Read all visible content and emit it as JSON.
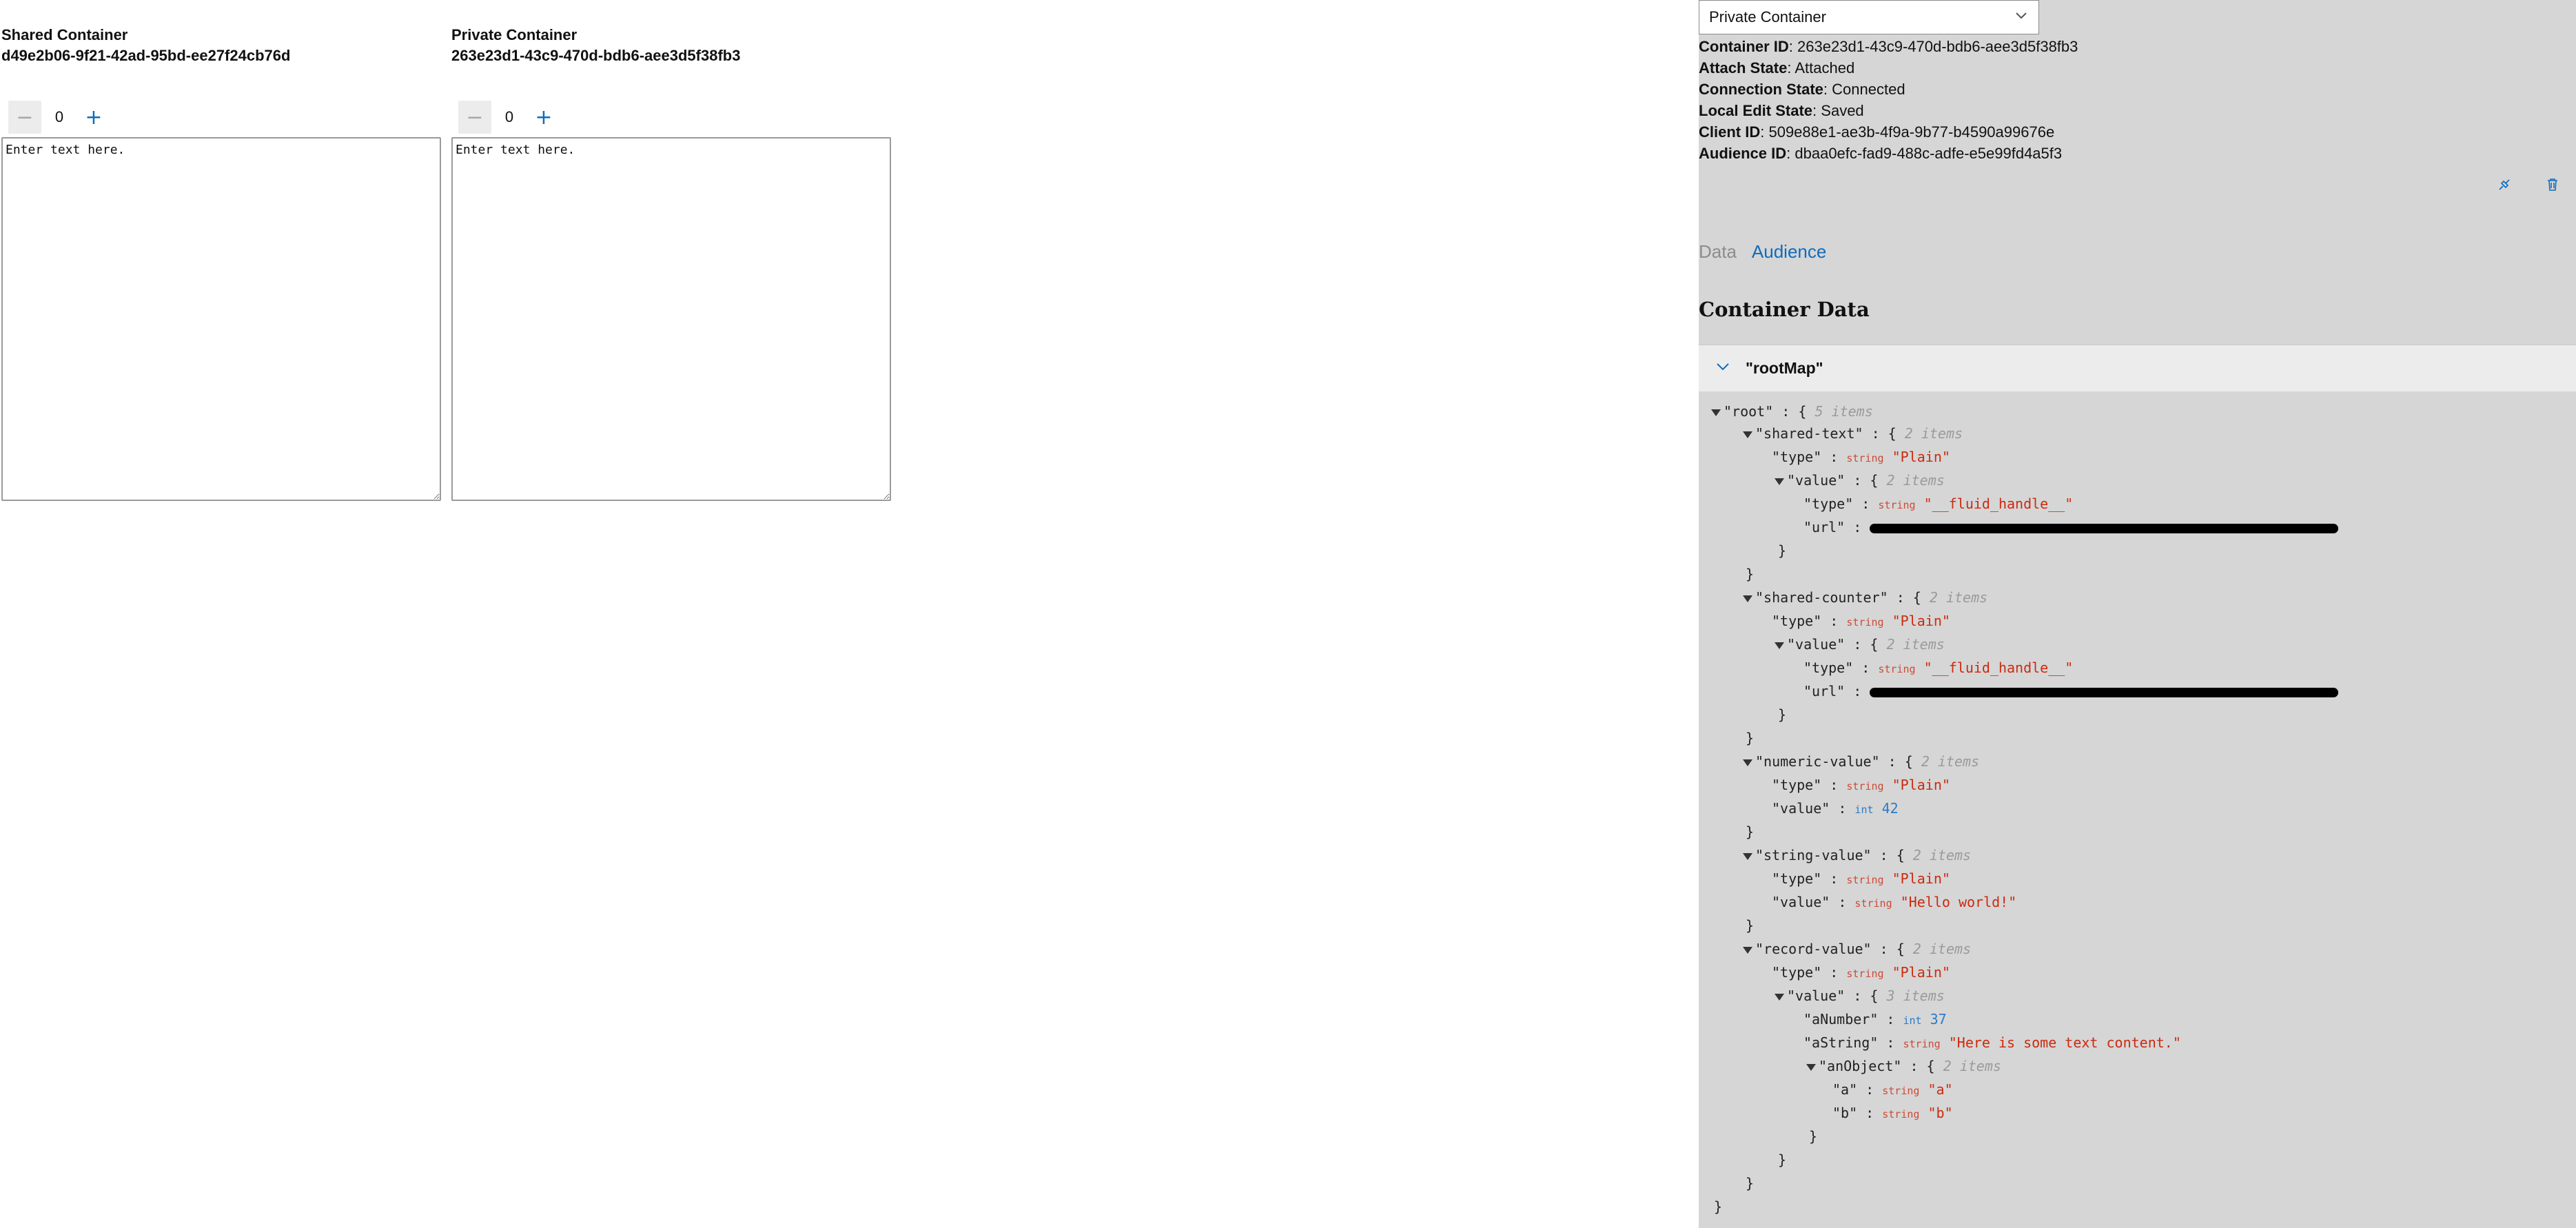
{
  "shared": {
    "title": "Shared Container",
    "id": "d49e2b06-9f21-42ad-95bd-ee27f24cb76d",
    "counter": "0",
    "decrement": "−",
    "increment": "+",
    "placeholder": "Enter text here."
  },
  "private": {
    "title": "Private Container",
    "id": "263e23d1-43c9-470d-bdb6-aee3d5f38fb3",
    "counter": "0",
    "decrement": "−",
    "increment": "+",
    "placeholder": "Enter text here."
  },
  "devtools": {
    "selected_container": "Private Container",
    "info": [
      {
        "label": "Container ID",
        "value": "263e23d1-43c9-470d-bdb6-aee3d5f38fb3"
      },
      {
        "label": "Attach State",
        "value": "Attached"
      },
      {
        "label": "Connection State",
        "value": "Connected"
      },
      {
        "label": "Local Edit State",
        "value": "Saved"
      },
      {
        "label": "Client ID",
        "value": "509e88e1-ae3b-4f9a-9b77-b4590a99676e"
      },
      {
        "label": "Audience ID",
        "value": "dbaa0efc-fad9-488c-adfe-e5e99fd4a5f3"
      }
    ],
    "tabs": {
      "data": "Data",
      "audience": "Audience"
    },
    "section_title": "Container Data",
    "accordion_label": "\"rootMap\"",
    "colors": {
      "accent": "#0f6cbd",
      "panel_bg": "#d6d6d6",
      "string_value": "#cc2a0f",
      "number_value": "#2b7bc8"
    }
  },
  "tree": {
    "root_key": "\"root\"",
    "root_meta": "5 items",
    "shared_text_key": "\"shared-text\"",
    "shared_text_meta": "2 items",
    "type_key": "\"type\"",
    "value_key": "\"value\"",
    "url_key": "\"url\"",
    "string_type": "string",
    "int_type": "int",
    "plain": "\"Plain\"",
    "fluid_handle": "\"__fluid_handle__\"",
    "two_items": "2 items",
    "three_items": "3 items",
    "shared_counter_key": "\"shared-counter\"",
    "numeric_value_key": "\"numeric-value\"",
    "numeric_value": "42",
    "string_value_key": "\"string-value\"",
    "string_value": "\"Hello world!\"",
    "record_value_key": "\"record-value\"",
    "anumber_key": "\"aNumber\"",
    "anumber_value": "37",
    "astring_key": "\"aString\"",
    "astring_value": "\"Here is some text content.\"",
    "anobject_key": "\"anObject\"",
    "a_key": "\"a\"",
    "a_value": "\"a\"",
    "b_key": "\"b\"",
    "b_value": "\"b\""
  }
}
